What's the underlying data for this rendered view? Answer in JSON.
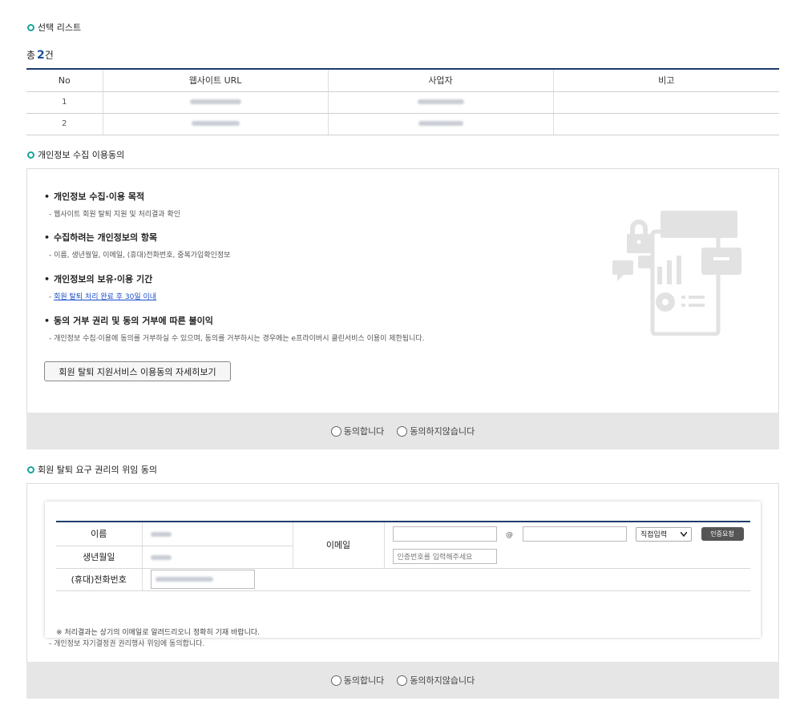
{
  "select_list": {
    "title": "선택 리스트",
    "total_prefix": "총",
    "total_count": "2",
    "total_suffix": "건",
    "headers": [
      "No",
      "웹사이트 URL",
      "사업자",
      "비고"
    ],
    "rows": [
      {
        "no": "1",
        "url": "[masked]",
        "company": "[masked]",
        "note": ""
      },
      {
        "no": "2",
        "url": "[masked]",
        "company": "[masked]",
        "note": ""
      }
    ]
  },
  "privacy": {
    "title": "개인정보 수집 이용동의",
    "items": [
      {
        "heading": "개인정보 수집·이용 목적",
        "desc": "- 웹사이트 회원 탈퇴 지원 및 처리결과 확인"
      },
      {
        "heading": "수집하려는 개인정보의 항목",
        "desc": "- 이름, 생년월일, 이메일, (휴대)전화번호, 중복가입확인정보"
      },
      {
        "heading": "개인정보의 보유·이용 기간",
        "desc_prefix": "- ",
        "desc_link": "회원 탈퇴 처리 완료 후 30일 이내"
      },
      {
        "heading": "동의 거부 권리 및 동의 거부에 따른 불이익",
        "desc": "- 개인정보 수집·이용에 동의를 거부하실 수 있으며, 동의를 거부하시는 경우에는 e프라이버시 클린서비스 이용이 제한됩니다."
      }
    ],
    "detail_button": "회원 탈퇴 지원서비스 이용동의 자세히보기",
    "agree": "동의합니다",
    "disagree": "동의하지않습니다"
  },
  "delegation": {
    "title": "회원 탈퇴 요구 권리의 위임 동의",
    "name_label": "이름",
    "name_value": "[masked]",
    "birth_label": "생년월일",
    "birth_value": "[masked]",
    "phone_label": "(휴대)전화번호",
    "phone_value": "[masked]",
    "email_label": "이메일",
    "email_local": "",
    "email_at": "@",
    "email_domain": "",
    "domain_select": "직접입력",
    "request_button": "인증요청",
    "code_placeholder": "인증번호를 입력해주세요",
    "notice": "※ 처리결과는 상기의 이메일로 알려드리오니 정확히 기재 바랍니다.",
    "consent_text": "- 개인정보 자기결정권 권리행사 위임에 동의합니다.",
    "agree": "동의합니다",
    "disagree": "동의하지않습니다"
  },
  "colors": {
    "accent_ring": "#1aa39a",
    "table_border": "#1f3d6b",
    "count": "#1b4f9c",
    "link": "#1a4fc9",
    "agree_bar": "#e6e6e6"
  },
  "icons": [
    "privacy-illustration-icon",
    "circle-bullet-icon",
    "radio-icon",
    "chevron-down-icon"
  ]
}
